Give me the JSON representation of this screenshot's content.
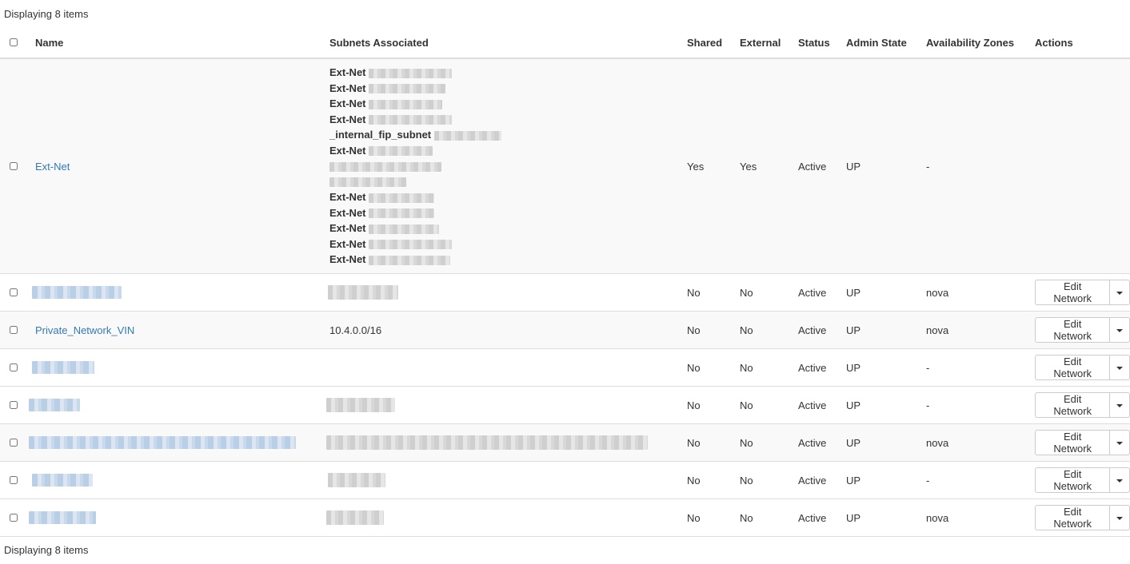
{
  "summary": "Displaying 8 items",
  "columns": {
    "name": "Name",
    "subnets": "Subnets Associated",
    "shared": "Shared",
    "external": "External",
    "status": "Status",
    "admin_state": "Admin State",
    "zones": "Availability Zones",
    "actions": "Actions"
  },
  "ext_net": {
    "name": "Ext-Net",
    "subnets": [
      "Ext-Net",
      "Ext-Net",
      "Ext-Net",
      "Ext-Net",
      "_internal_fip_subnet",
      "Ext-Net",
      "",
      "",
      "Ext-Net",
      "Ext-Net",
      "Ext-Net",
      "Ext-Net",
      "Ext-Net"
    ],
    "shared": "Yes",
    "external": "Yes",
    "status": "Active",
    "admin_state": "UP",
    "zones": "-"
  },
  "rows": [
    {
      "name": "",
      "subnet": "",
      "shared": "No",
      "external": "No",
      "status": "Active",
      "admin_state": "UP",
      "zones": "nova"
    },
    {
      "name": "Private_Network_VIN",
      "subnet": "10.4.0.0/16",
      "shared": "No",
      "external": "No",
      "status": "Active",
      "admin_state": "UP",
      "zones": "nova"
    },
    {
      "name": "",
      "subnet": "",
      "shared": "No",
      "external": "No",
      "status": "Active",
      "admin_state": "UP",
      "zones": "-"
    },
    {
      "name": "",
      "subnet": "",
      "shared": "No",
      "external": "No",
      "status": "Active",
      "admin_state": "UP",
      "zones": "-"
    },
    {
      "name": "",
      "subnet": "",
      "shared": "No",
      "external": "No",
      "status": "Active",
      "admin_state": "UP",
      "zones": "nova"
    },
    {
      "name": "",
      "subnet": "",
      "shared": "No",
      "external": "No",
      "status": "Active",
      "admin_state": "UP",
      "zones": "-"
    },
    {
      "name": "",
      "subnet": "",
      "shared": "No",
      "external": "No",
      "status": "Active",
      "admin_state": "UP",
      "zones": "nova"
    }
  ],
  "edit_label": "Edit Network",
  "icons": {
    "row_actions": "chevron-down-icon"
  }
}
